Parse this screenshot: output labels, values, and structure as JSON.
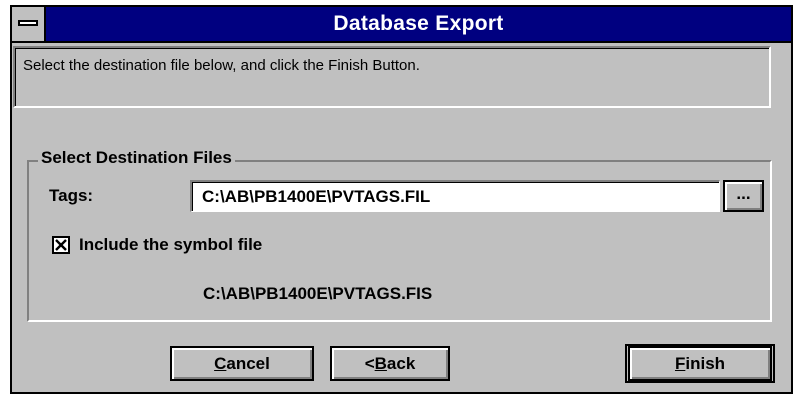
{
  "window": {
    "title": "Database Export"
  },
  "instruction": {
    "text": "Select the destination file below, and click the Finish  Button."
  },
  "group": {
    "legend": "Select Destination Files",
    "tags_label": "Tags:",
    "tags_value": "C:\\AB\\PB1400E\\PVTAGS.FIL",
    "browse_label": "...",
    "include_symbol": {
      "checked": true,
      "label": "Include the symbol file"
    },
    "symbol_path": "C:\\AB\\PB1400E\\PVTAGS.FIS"
  },
  "buttons": {
    "cancel": {
      "mnemonic": "C",
      "rest": "ancel"
    },
    "back": {
      "prefix": "<",
      "mnemonic": "B",
      "rest": "ack"
    },
    "finish": {
      "mnemonic": "F",
      "rest": "inish"
    }
  },
  "colors": {
    "title_bar": "#000080",
    "face": "#c0c0c0",
    "shadow": "#808080"
  },
  "icons": {
    "system_menu": "system-menu-icon",
    "checkbox": "check-x-icon"
  }
}
